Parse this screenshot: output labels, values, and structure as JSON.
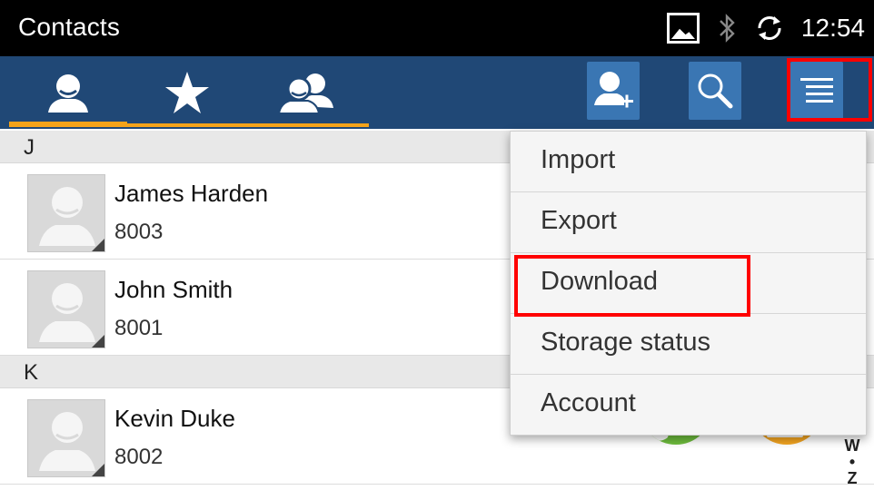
{
  "status_bar": {
    "title": "Contacts",
    "time": "12:54",
    "icons": [
      "gallery-icon",
      "bluetooth-icon",
      "sync-icon"
    ]
  },
  "toolbar": {
    "tabs": [
      {
        "name": "contacts",
        "icon": "person-icon",
        "selected": true
      },
      {
        "name": "favorites",
        "icon": "star-icon",
        "selected": false
      },
      {
        "name": "groups",
        "icon": "group-icon",
        "selected": false
      }
    ],
    "actions": [
      {
        "name": "add-contact",
        "icon": "add-person-icon"
      },
      {
        "name": "search",
        "icon": "search-icon"
      },
      {
        "name": "menu",
        "icon": "menu-icon",
        "highlighted": true
      }
    ],
    "colors": {
      "bar": "#204876",
      "button": "#3a76b3",
      "tab_indicator": "#f4a31a"
    }
  },
  "contacts": {
    "sections": [
      {
        "letter": "J",
        "items": [
          {
            "name": "James Harden",
            "number": "8003"
          },
          {
            "name": "John Smith",
            "number": "8001"
          }
        ]
      },
      {
        "letter": "K",
        "items": [
          {
            "name": "Kevin Duke",
            "number": "8002"
          }
        ]
      }
    ],
    "index_bar": {
      "top": "W",
      "dot": "•",
      "bottom": "Z"
    }
  },
  "menu": {
    "items": [
      "Import",
      "Export",
      "Download",
      "Storage status",
      "Account"
    ],
    "highlighted": "Download",
    "highlight_color": "#ff0000"
  }
}
